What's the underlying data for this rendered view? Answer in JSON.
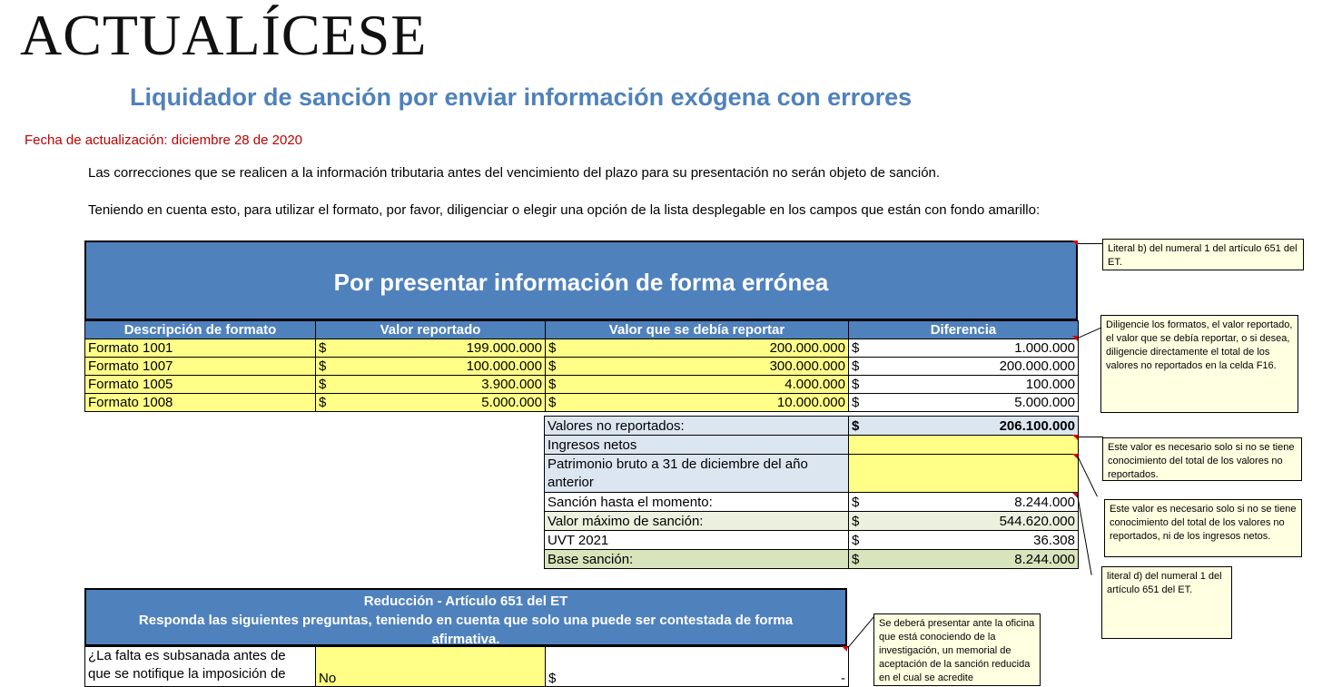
{
  "logo": {
    "text": "ACTUALÍCESE"
  },
  "title": "Liquidador de sanción por enviar información exógena con errores",
  "update_date": "Fecha de actualización: diciembre 28 de 2020",
  "intro": [
    "Las correcciones que se realicen a la información tributaria antes del vencimiento del plazo para su presentación no serán objeto de sanción.",
    "Teniendo en cuenta esto, para utilizar el formato, por favor, diligenciar o elegir una opción de la lista desplegable en los campos que están con fondo amarillo:"
  ],
  "section1": {
    "header": "Por presentar información de forma errónea",
    "columns": [
      "Descripción de formato",
      "Valor reportado",
      "Valor que se debía reportar",
      "Diferencia"
    ],
    "rows": [
      {
        "format": "Formato 1001",
        "reported": "199.000.000",
        "should": "200.000.000",
        "diff": "1.000.000"
      },
      {
        "format": "Formato 1007",
        "reported": "100.000.000",
        "should": "300.000.000",
        "diff": "200.000.000"
      },
      {
        "format": "Formato 1005",
        "reported": "3.900.000",
        "should": "4.000.000",
        "diff": "100.000"
      },
      {
        "format": "Formato 1008",
        "reported": "5.000.000",
        "should": "10.000.000",
        "diff": "5.000.000"
      }
    ],
    "currency": "$",
    "summary": {
      "no_reportados_label": "Valores no reportados:",
      "no_reportados_value": "206.100.000",
      "ingresos_label": "Ingresos netos",
      "patrimonio_label_1": "Patrimonio bruto a 31 de diciembre del año",
      "patrimonio_label_2": "anterior",
      "sancion_label": "Sanción hasta el momento:",
      "sancion_value": "8.244.000",
      "max_label": "Valor máximo de sanción:",
      "max_value": "544.620.000",
      "uvt_label": "UVT 2021",
      "uvt_value": "36.308",
      "base_label": "Base sanción:",
      "base_value": "8.244.000"
    }
  },
  "section2": {
    "line1": "Reducción - Artículo 651 del ET",
    "line2": "Responda las siguientes preguntas, teniendo en cuenta que solo una puede ser contestada de forma",
    "line3": "afirmativa.",
    "question_1": "¿La falta es subsanada antes de",
    "question_2": "que se notifique la imposición de",
    "answer": "No",
    "currency": "$",
    "value": "-"
  },
  "notes": {
    "n1": "Literal b) del numeral 1 del artículo 651 del ET.",
    "n2": "Diligencie los formatos, el valor reportado, el valor que se debía reportar, o si desea, diligencie directamente el total de los valores no reportados en la celda F16.",
    "n3": "Este valor es necesario solo si no se tiene conocimiento del total de los valores no reportados.",
    "n4": "Este valor es necesario solo si no se tiene conocimiento del total de los valores no reportados, ni de los ingresos netos.",
    "n5": "literal d) del numeral 1 del artículo 651 del ET.",
    "n6": "Se deberá presentar ante la oficina que está conociendo de la investigación, un memorial de aceptación de la sanción reducida en el cual se acredite"
  },
  "colors": {
    "header_blue": "#4f81bd",
    "input_yellow": "#ffff88",
    "date_red": "#c00000"
  }
}
